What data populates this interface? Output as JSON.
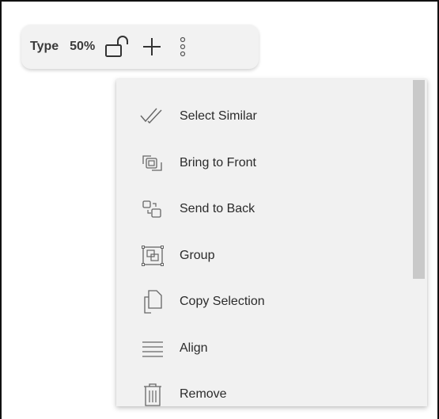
{
  "toolbar": {
    "type_label": "Type",
    "zoom_label": "50%",
    "icons": [
      "lock-open-icon",
      "plus-icon",
      "more-vertical-icon"
    ]
  },
  "menu": {
    "items": [
      {
        "label": "Select Similar",
        "icon": "check-double-icon"
      },
      {
        "label": "Bring to Front",
        "icon": "bring-to-front-icon"
      },
      {
        "label": "Send to Back",
        "icon": "send-to-back-icon"
      },
      {
        "label": "Group",
        "icon": "group-icon"
      },
      {
        "label": "Copy Selection",
        "icon": "copy-icon"
      },
      {
        "label": "Align",
        "icon": "align-icon"
      },
      {
        "label": "Remove",
        "icon": "trash-icon"
      }
    ]
  },
  "colors": {
    "toolbar_bg": "#f2f2f2",
    "menu_bg": "#f1f1f1",
    "text": "#2b2b2b",
    "icon": "#555555"
  }
}
